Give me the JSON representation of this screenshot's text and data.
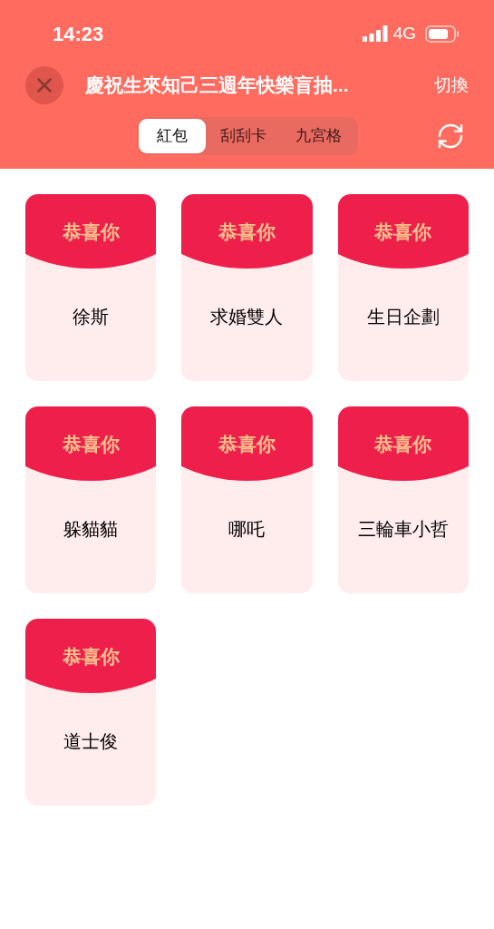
{
  "status_bar": {
    "time": "14:23",
    "network": "4G"
  },
  "header": {
    "title": "慶祝生來知己三週年快樂盲抽...",
    "switch_label": "切換"
  },
  "tabs": [
    {
      "label": "紅包",
      "selected": true
    },
    {
      "label": "刮刮卡",
      "selected": false
    },
    {
      "label": "九宮格",
      "selected": false
    }
  ],
  "cards": [
    {
      "header": "恭喜你",
      "name": "徐斯"
    },
    {
      "header": "恭喜你",
      "name": "求婚雙人"
    },
    {
      "header": "恭喜你",
      "name": "生日企劃"
    },
    {
      "header": "恭喜你",
      "name": "躲貓貓"
    },
    {
      "header": "恭喜你",
      "name": "哪吒"
    },
    {
      "header": "恭喜你",
      "name": "三輪車小哲"
    },
    {
      "header": "恭喜你",
      "name": "道士俊"
    }
  ]
}
